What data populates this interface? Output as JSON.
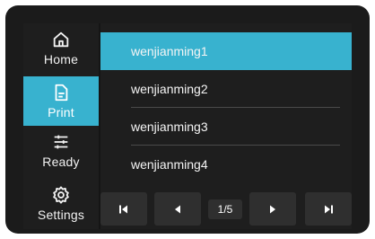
{
  "sidebar": {
    "items": [
      {
        "label": "Home",
        "icon": "home-icon"
      },
      {
        "label": "Print",
        "icon": "file-icon",
        "active": true
      },
      {
        "label": "Ready",
        "icon": "sliders-icon"
      },
      {
        "label": "Settings",
        "icon": "gear-icon"
      }
    ]
  },
  "files": [
    {
      "name": "wenjianming1",
      "selected": true
    },
    {
      "name": "wenjianming2"
    },
    {
      "name": "wenjianming3"
    },
    {
      "name": "wenjianming4"
    }
  ],
  "pager": {
    "page_indicator": "1/5",
    "buttons": [
      "first-page-icon",
      "prev-page-icon",
      "next-page-icon",
      "last-page-icon"
    ]
  },
  "colors": {
    "accent": "#38b2cf",
    "background": "#1e1e1e",
    "button": "#2f2f2f",
    "text": "#f5f5f5"
  }
}
